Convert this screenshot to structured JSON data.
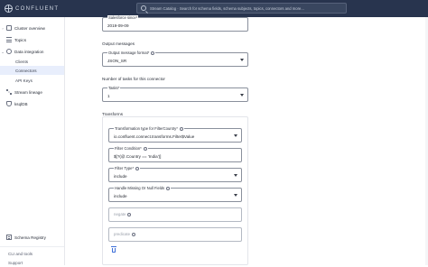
{
  "app": {
    "logo_text": "CONFLUENT"
  },
  "search": {
    "placeholder": "Stream Catalog · Search for schema fields, schema subjects, topics, connectors and more..."
  },
  "sidebar": {
    "items": [
      {
        "label": "Cluster overview",
        "icon": "cluster-icon"
      },
      {
        "label": "Topics",
        "icon": "topics-icon"
      },
      {
        "label": "Data integration",
        "icon": "integration-icon"
      },
      {
        "label": "Clients"
      },
      {
        "label": "Connectors"
      },
      {
        "label": "API Keys"
      },
      {
        "label": "Stream lineage",
        "icon": "lineage-icon"
      },
      {
        "label": "ksqlDB",
        "icon": "ksqldb-icon"
      },
      {
        "label": "Schema Registry",
        "icon": "schema-registry-icon"
      },
      {
        "label": "CLI and tools"
      },
      {
        "label": "Support"
      }
    ]
  },
  "form": {
    "salesforce_since": {
      "label": "Salesforce since*",
      "value": "2019-09-09"
    },
    "output_messages": {
      "section": "Output messages",
      "format": {
        "label": "Output message format*",
        "value": "JSON_SR"
      }
    },
    "tasks": {
      "section": "Number of tasks for this connector",
      "field": {
        "label": "Tasks*",
        "value": "1"
      }
    },
    "transforms": {
      "section": "Transforms",
      "type": {
        "label": "Transformation type for FilterCountry*",
        "value": "io.confluent.connect.transforms.Filter$Value"
      },
      "condition": {
        "label": "Filter Condition*",
        "value": "$[?(@.Country == 'India')]"
      },
      "filter_type": {
        "label": "Filter Type*",
        "value": "include"
      },
      "missing": {
        "label": "Handle Missing Or Null Fields",
        "value": "include"
      },
      "negate": {
        "placeholder": "negate"
      },
      "predicate": {
        "placeholder": "predicate"
      }
    }
  },
  "colors": {
    "topbar": "#28344e",
    "accent": "#3d6fd8",
    "active_nav": "#e8eefc"
  }
}
